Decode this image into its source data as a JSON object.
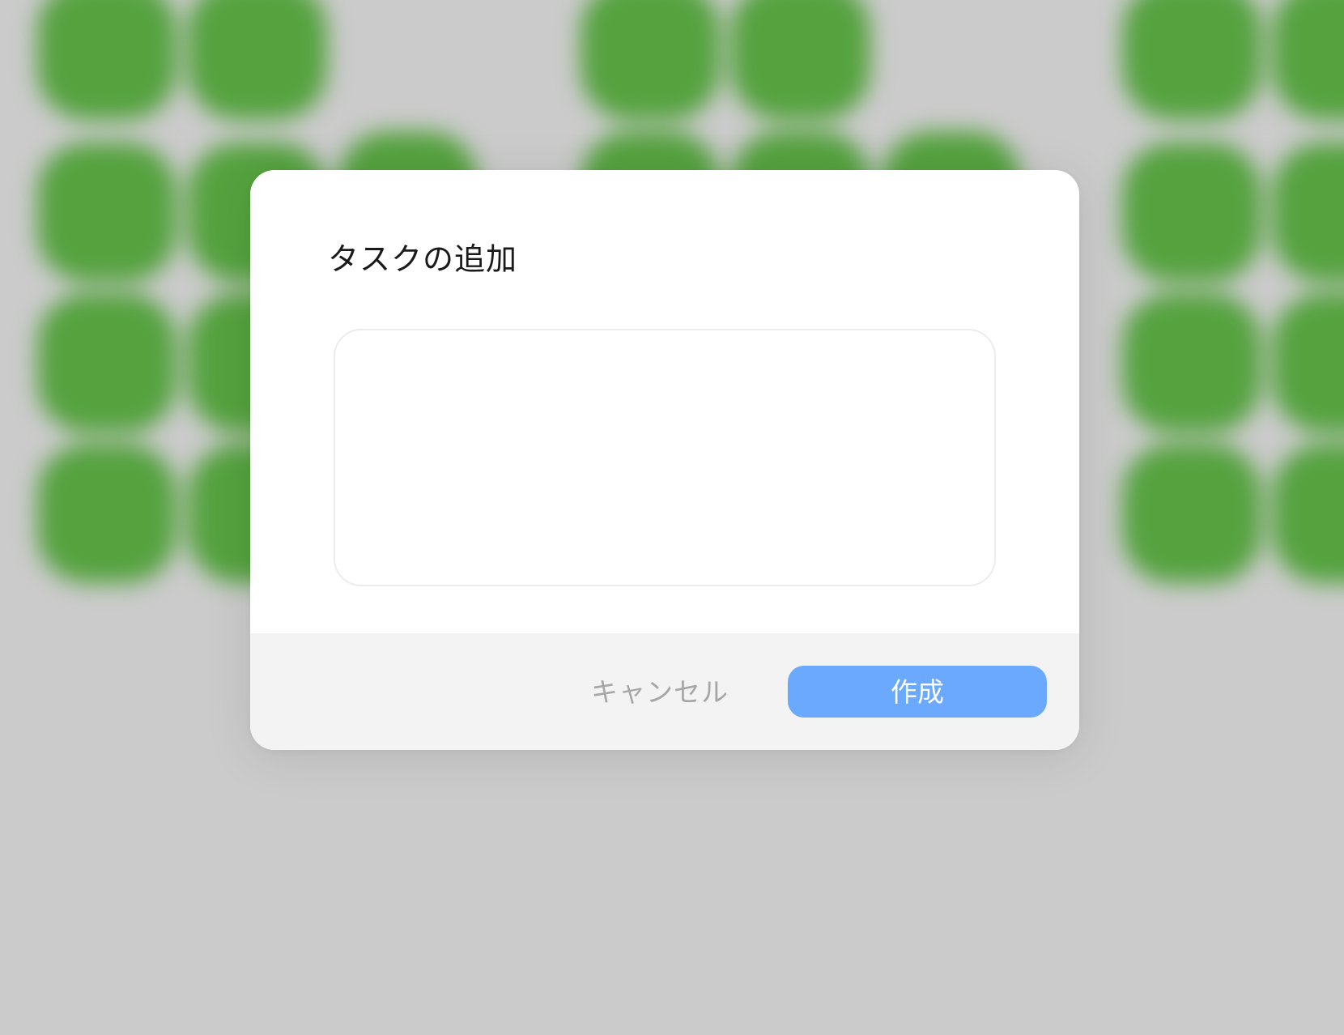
{
  "dialog": {
    "title": "タスクの追加",
    "input": {
      "value": "",
      "placeholder": ""
    },
    "cancel_label": "キャンセル",
    "create_label": "作成"
  },
  "colors": {
    "backdrop": "#cbcbcb",
    "background_tile": "#55a23f",
    "dialog_bg": "#ffffff",
    "footer_bg": "#f3f3f3",
    "primary_button": "#6aa9fd",
    "cancel_text": "#a6a6a6"
  }
}
